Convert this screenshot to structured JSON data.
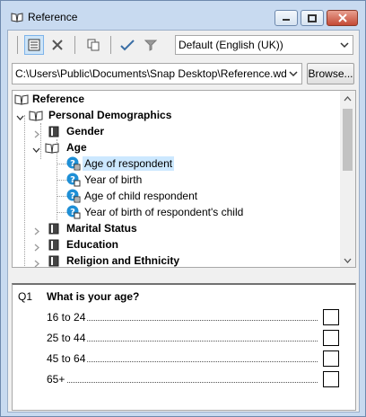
{
  "window": {
    "title": "Reference",
    "buttons": {
      "minimize": "minimize",
      "maximize": "maximize",
      "close": "close"
    }
  },
  "toolbar": {
    "tools": [
      "reference-view-icon",
      "tools-icon",
      "copy-icon",
      "check-icon",
      "filter-icon"
    ],
    "language": "Default (English (UK))"
  },
  "path_bar": {
    "path": "C:\\Users\\Public\\Documents\\Snap Desktop\\Reference.wd",
    "browse_label": "Browse..."
  },
  "tree": {
    "root": "Reference",
    "items": [
      {
        "label": "Personal Demographics",
        "bold": true
      },
      {
        "label": "Gender",
        "bold": true
      },
      {
        "label": "Age",
        "bold": true
      },
      {
        "label": "Age of respondent",
        "bold": false
      },
      {
        "label": "Year of birth",
        "bold": false
      },
      {
        "label": "Age of child respondent",
        "bold": false
      },
      {
        "label": "Year of birth of respondent's child",
        "bold": false
      },
      {
        "label": "Marital Status",
        "bold": true
      },
      {
        "label": "Education",
        "bold": true
      },
      {
        "label": "Religion and Ethnicity",
        "bold": true
      }
    ]
  },
  "question": {
    "number": "Q1",
    "text": "What is your age?",
    "answers": [
      "16 to 24",
      "25 to 44",
      "45 to 64",
      "65+"
    ]
  }
}
